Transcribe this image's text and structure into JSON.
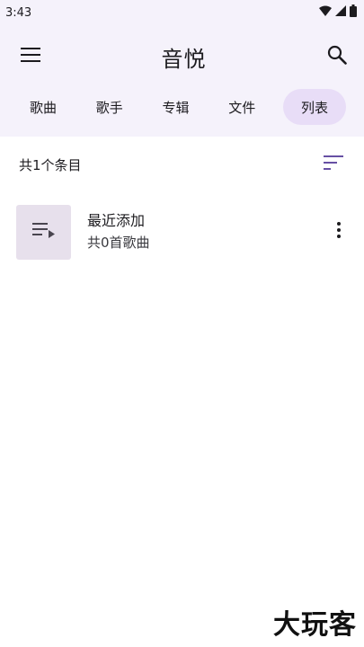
{
  "status_bar": {
    "time": "3:43"
  },
  "app_bar": {
    "title": "音悦"
  },
  "tabs": [
    {
      "label": "歌曲",
      "active": false
    },
    {
      "label": "歌手",
      "active": false
    },
    {
      "label": "专辑",
      "active": false
    },
    {
      "label": "文件",
      "active": false
    },
    {
      "label": "列表",
      "active": true
    }
  ],
  "summary": {
    "count_text": "共1个条目"
  },
  "playlists": [
    {
      "title": "最近添加",
      "subtitle": "共0首歌曲"
    }
  ],
  "watermark": "大玩客",
  "colors": {
    "header_bg": "#f5f2fb",
    "active_tab_bg": "#e8ddf7",
    "accent": "#6750a4",
    "thumb_bg": "#e7e0ec"
  },
  "icons": [
    "menu-icon",
    "search-icon",
    "sort-icon",
    "playlist-icon",
    "more-vertical-icon",
    "wifi-icon",
    "signal-icon",
    "battery-icon"
  ]
}
